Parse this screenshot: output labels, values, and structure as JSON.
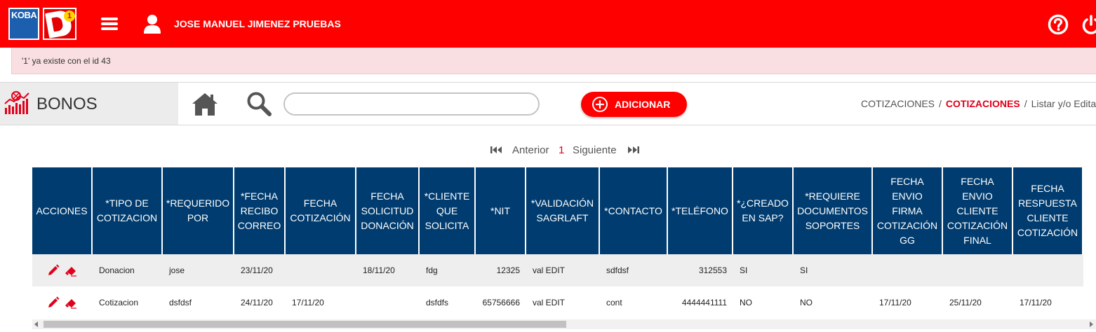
{
  "header": {
    "logo_text": "KOBA",
    "logo2_badge": "1",
    "user_name": "JOSE MANUEL JIMENEZ PRUEBAS",
    "brand_color": "#ff0000"
  },
  "alert": {
    "message": "'1' ya existe con el id 43"
  },
  "module": {
    "title": "BONOS",
    "search_placeholder": "",
    "search_value": "",
    "add_label": "ADICIONAR",
    "add_icon": "plus-circle-icon"
  },
  "breadcrumb": {
    "items": [
      "COTIZACIONES",
      "COTIZACIONES",
      "Listar y/o Editar"
    ],
    "separator": "/"
  },
  "pager": {
    "prev_label": "Anterior",
    "current_page": "1",
    "next_label": "Siguiente"
  },
  "table": {
    "header_color": "#003c6f",
    "columns": [
      "ACCIONES",
      "*TIPO DE COTIZACION",
      "*REQUERIDO POR",
      "*FECHA RECIBO CORREO",
      "FECHA COTIZACIÓN",
      "FECHA SOLICITUD DONACIÓN",
      "*CLIENTE QUE SOLICITA",
      "*NIT",
      "*VALIDACIÓN SAGRLAFT",
      "*CONTACTO",
      "*TELÉFONO",
      "*¿CREADO EN SAP?",
      "*REQUIERE DOCUMENTOS SOPORTES",
      "FECHA ENVIO FIRMA COTIZACIÓN GG",
      "FECHA ENVIO CLIENTE COTIZACIÓN FINAL",
      "FECHA RESPUESTA CLIENTE COTIZACIÓN"
    ],
    "rows": [
      [
        "",
        "Donacion",
        "jose",
        "23/11/20",
        "",
        "18/11/20",
        "fdg",
        "12325",
        "val EDIT",
        "sdfdsf",
        "312553",
        "SI",
        "SI",
        "",
        "",
        ""
      ],
      [
        "",
        "Cotizacion",
        "dsfdsf",
        "24/11/20",
        "17/11/20",
        "",
        "dsfdfs",
        "65756666",
        "val EDIT",
        "cont",
        "4444441111",
        "NO",
        "NO",
        "17/11/20",
        "25/11/20",
        "17/11/20"
      ]
    ],
    "row_actions": [
      "edit-pencil-icon",
      "erase-icon"
    ]
  }
}
